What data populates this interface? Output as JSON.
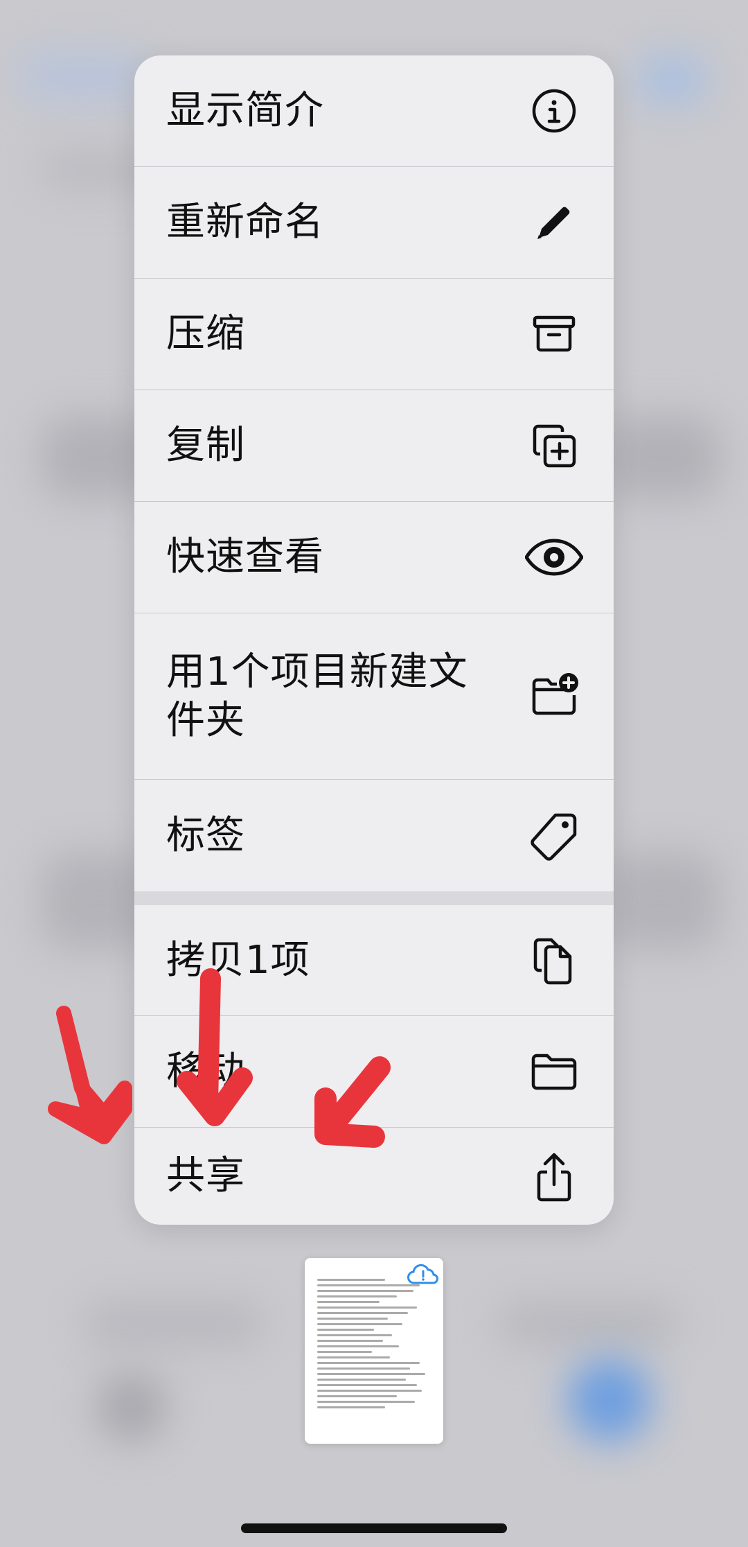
{
  "menu": {
    "items": [
      {
        "label": "显示简介",
        "icon": "info-circle-icon"
      },
      {
        "label": "重新命名",
        "icon": "pencil-icon"
      },
      {
        "label": "压缩",
        "icon": "archive-box-icon"
      },
      {
        "label": "复制",
        "icon": "duplicate-plus-icon"
      },
      {
        "label": "快速查看",
        "icon": "eye-icon"
      },
      {
        "label": "用1个项目新建文件夹",
        "icon": "folder-badge-plus-icon"
      },
      {
        "label": "标签",
        "icon": "tag-icon"
      }
    ],
    "items2": [
      {
        "label": "拷贝1项",
        "icon": "copy-documents-icon"
      },
      {
        "label": "移动",
        "icon": "folder-icon"
      },
      {
        "label": "共享",
        "icon": "share-icon"
      }
    ]
  },
  "colors": {
    "menu_bg": "#eeeef0",
    "backdrop": "#c9c9ce",
    "annotation_arrow": "#e8353b",
    "cloud_icon": "#2f8ee8"
  }
}
